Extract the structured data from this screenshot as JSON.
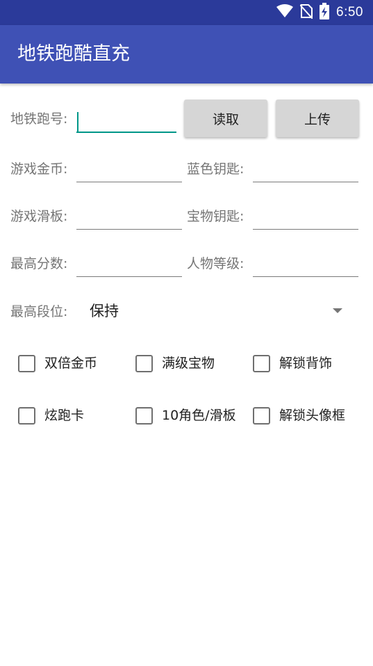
{
  "status_bar": {
    "time": "6:50",
    "icons": [
      "wifi-icon",
      "no-sim-icon",
      "battery-charging-icon"
    ]
  },
  "app_bar": {
    "title": "地铁跑酷直充",
    "color": "#3f51b5"
  },
  "form": {
    "account_label": "地铁跑号:",
    "account_value": "",
    "read_button": "读取",
    "upload_button": "上传",
    "coins_label": "游戏金币:",
    "coins_value": "",
    "blue_keys_label": "蓝色钥匙:",
    "blue_keys_value": "",
    "skateboard_label": "游戏滑板:",
    "skateboard_value": "",
    "treasure_keys_label": "宝物钥匙:",
    "treasure_keys_value": "",
    "high_score_label": "最高分数:",
    "high_score_value": "",
    "character_level_label": "人物等级:",
    "character_level_value": "",
    "rank_label": "最高段位:",
    "rank_value": "保持"
  },
  "options": [
    {
      "label": "双倍金币",
      "checked": false
    },
    {
      "label": "满级宝物",
      "checked": false
    },
    {
      "label": "解锁背饰",
      "checked": false
    },
    {
      "label": "炫跑卡",
      "checked": false
    },
    {
      "label": "10角色/滑板",
      "checked": false
    },
    {
      "label": "解锁头像框",
      "checked": false
    }
  ],
  "colors": {
    "accent": "#009688",
    "primary": "#3f51b5",
    "status_bar": "#2b3a9a"
  }
}
